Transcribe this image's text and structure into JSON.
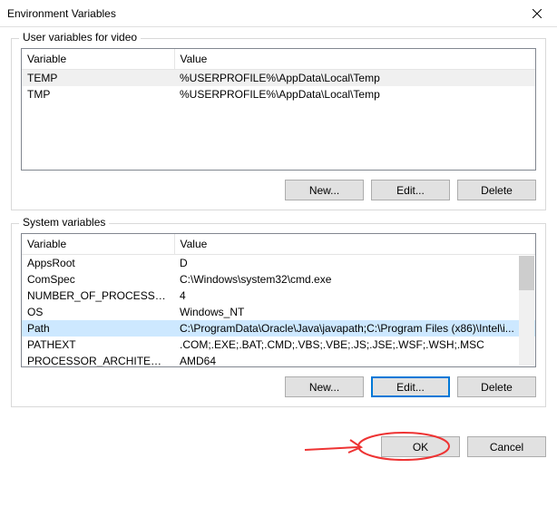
{
  "title": "Environment Variables",
  "user_group_label": "User variables for video",
  "system_group_label": "System variables",
  "columns": {
    "variable": "Variable",
    "value": "Value"
  },
  "user_vars": [
    {
      "name": "TEMP",
      "value": "%USERPROFILE%\\AppData\\Local\\Temp"
    },
    {
      "name": "TMP",
      "value": "%USERPROFILE%\\AppData\\Local\\Temp"
    }
  ],
  "system_vars": [
    {
      "name": "AppsRoot",
      "value": "D"
    },
    {
      "name": "ComSpec",
      "value": "C:\\Windows\\system32\\cmd.exe"
    },
    {
      "name": "NUMBER_OF_PROCESSORS",
      "value": "4"
    },
    {
      "name": "OS",
      "value": "Windows_NT"
    },
    {
      "name": "Path",
      "value": "C:\\ProgramData\\Oracle\\Java\\javapath;C:\\Program Files (x86)\\Intel\\i..."
    },
    {
      "name": "PATHEXT",
      "value": ".COM;.EXE;.BAT;.CMD;.VBS;.VBE;.JS;.JSE;.WSF;.WSH;.MSC"
    },
    {
      "name": "PROCESSOR_ARCHITECTURE",
      "value": "AMD64"
    }
  ],
  "user_selected_index": 0,
  "system_selected_index": 4,
  "buttons": {
    "new": "New...",
    "edit": "Edit...",
    "delete": "Delete",
    "ok": "OK",
    "cancel": "Cancel"
  }
}
